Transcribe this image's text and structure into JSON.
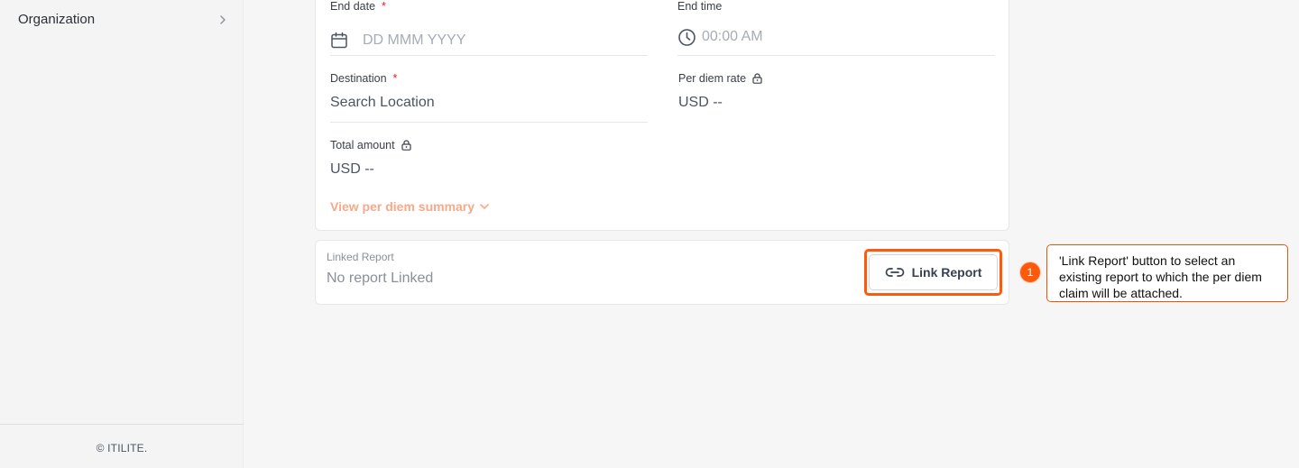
{
  "sidebar": {
    "item_label": "Organization",
    "footer": "© ITILITE."
  },
  "form": {
    "end_date": {
      "label": "End date",
      "required": "*",
      "placeholder": "DD MMM YYYY"
    },
    "end_time": {
      "label": "End time",
      "placeholder": "00:00 AM"
    },
    "destination": {
      "label": "Destination",
      "required": "*",
      "placeholder": "Search Location"
    },
    "per_diem_rate": {
      "label": "Per diem rate",
      "value": "USD --"
    },
    "total_amount": {
      "label": "Total amount",
      "value": "USD --"
    },
    "summary_link": "View per diem summary"
  },
  "linked_report": {
    "label": "Linked Report",
    "value": "No report Linked",
    "button_label": "Link Report"
  },
  "annotation": {
    "number": "1",
    "text": "'Link Report' button to select an existing report to which the per diem claim will be attached."
  },
  "colors": {
    "accent": "#ff5a0c",
    "link_text": "#f7a98a",
    "required": "#e11d1d"
  }
}
